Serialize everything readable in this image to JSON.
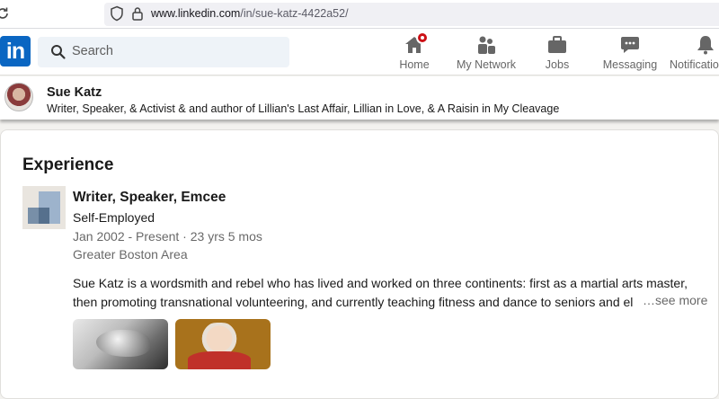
{
  "browser": {
    "url_host": "www.linkedin.com",
    "url_path": "/in/sue-katz-4422a52/"
  },
  "nav": {
    "logo_text": "in",
    "search_placeholder": "Search",
    "items": [
      {
        "label": "Home",
        "icon": "home-icon",
        "has_badge": true
      },
      {
        "label": "My Network",
        "icon": "people-icon"
      },
      {
        "label": "Jobs",
        "icon": "briefcase-icon"
      },
      {
        "label": "Messaging",
        "icon": "chat-icon"
      },
      {
        "label": "Notifications",
        "icon": "bell-icon"
      }
    ]
  },
  "profile": {
    "name": "Sue Katz",
    "headline": "Writer, Speaker, & Activist & and author of Lillian's Last Affair, Lillian in Love, & A Raisin in My Cleavage"
  },
  "experience": {
    "section_title": "Experience",
    "title": "Writer, Speaker, Emcee",
    "company": "Self-Employed",
    "dates": "Jan 2002 - Present · 23 yrs 5 mos",
    "location": "Greater Boston Area",
    "description_line1": "Sue Katz is a wordsmith and rebel who has lived and worked on three continents: first as a martial arts master,",
    "description_line2": "then promoting transnational volunteering, and currently teaching fitness and dance to seniors and el",
    "see_more": "…see more"
  },
  "colors": {
    "linkedin_blue": "#0a66c2",
    "badge_red": "#cc1016",
    "page_bg": "#f3f2ef"
  }
}
